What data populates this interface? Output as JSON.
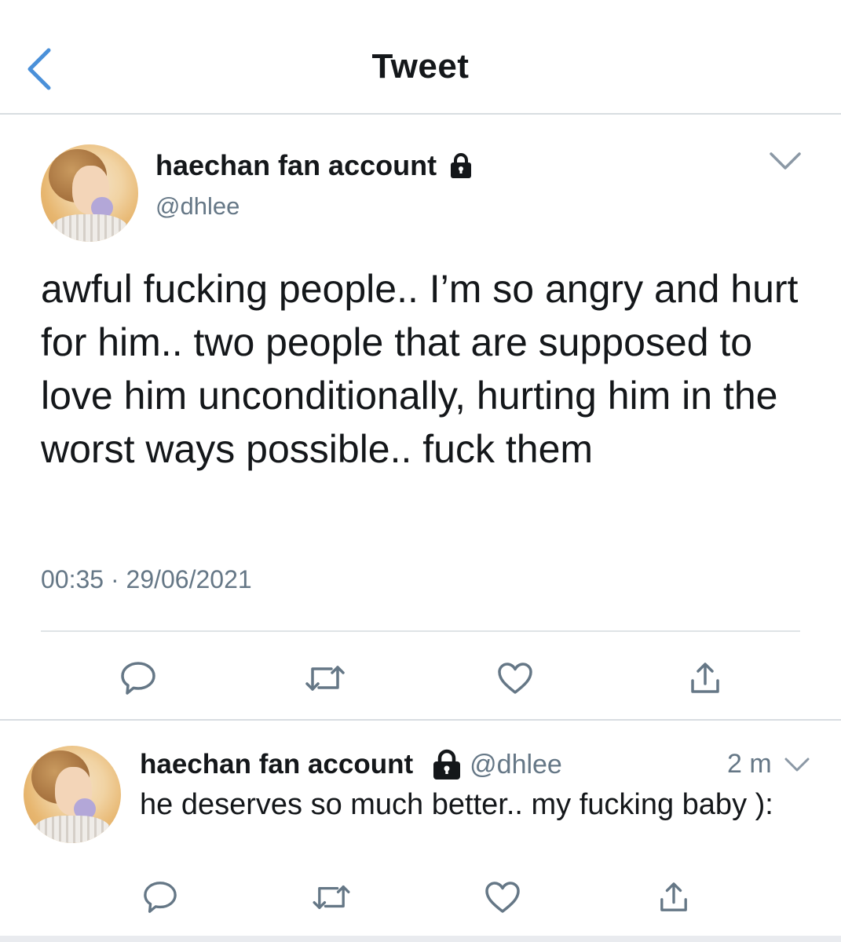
{
  "header": {
    "title": "Tweet",
    "back_icon": "chevron-left-icon",
    "accent_color": "#4a90d9"
  },
  "main_tweet": {
    "display_name": "haechan fan account",
    "handle": "@dhlee",
    "protected_icon": "lock-icon",
    "text": "awful fucking people.. I’m so angry and hurt for him.. two people that are supposed to love him unconditionally, hurting him in the worst ways possible.. fuck them",
    "timestamp": "00:35 · 29/06/2021",
    "actions": [
      "reply-icon",
      "retweet-icon",
      "like-icon",
      "share-icon"
    ]
  },
  "reply": {
    "display_name": "haechan fan account",
    "handle": "@dhlee",
    "protected_icon": "lock-icon",
    "time_ago": "2 m",
    "text": "he deserves so much better.. my fucking baby ):",
    "actions": [
      "reply-icon",
      "retweet-icon",
      "like-icon",
      "share-icon"
    ]
  }
}
